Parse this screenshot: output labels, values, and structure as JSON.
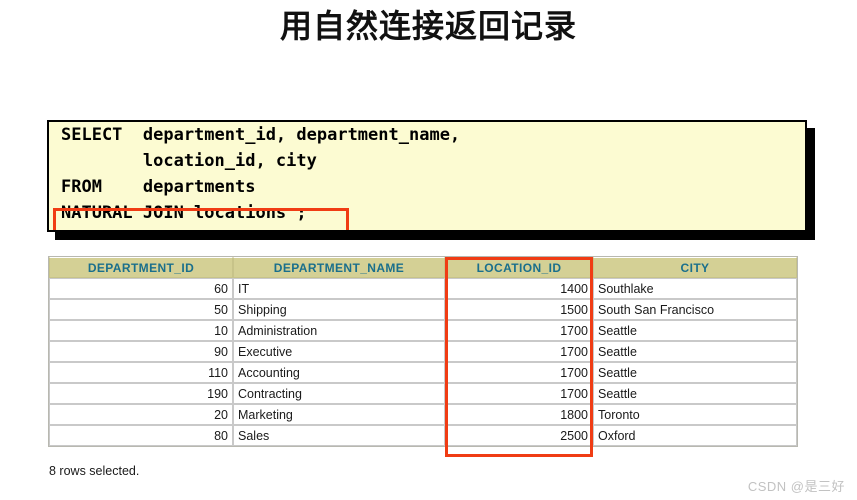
{
  "slide": {
    "title": "用自然连接返回记录"
  },
  "sql": {
    "lines": [
      "SELECT  department_id, department_name,",
      "        location_id, city",
      "FROM    departments",
      "NATURAL JOIN locations ;"
    ],
    "highlight_label": "NATURAL JOIN locations",
    "highlight_color": "#f03c14",
    "background_color": "#fcfbd2"
  },
  "table": {
    "headers": [
      "DEPARTMENT_ID",
      "DEPARTMENT_NAME",
      "LOCATION_ID",
      "CITY"
    ],
    "header_bg": "#d4d095",
    "header_color": "#1a6f8c",
    "rows": [
      {
        "department_id": "60",
        "department_name": "IT",
        "location_id": "1400",
        "city": "Southlake"
      },
      {
        "department_id": "50",
        "department_name": "Shipping",
        "location_id": "1500",
        "city": "South San Francisco"
      },
      {
        "department_id": "10",
        "department_name": "Administration",
        "location_id": "1700",
        "city": "Seattle"
      },
      {
        "department_id": "90",
        "department_name": "Executive",
        "location_id": "1700",
        "city": "Seattle"
      },
      {
        "department_id": "110",
        "department_name": "Accounting",
        "location_id": "1700",
        "city": "Seattle"
      },
      {
        "department_id": "190",
        "department_name": "Contracting",
        "location_id": "1700",
        "city": "Seattle"
      },
      {
        "department_id": "20",
        "department_name": "Marketing",
        "location_id": "1800",
        "city": "Toronto"
      },
      {
        "department_id": "80",
        "department_name": "Sales",
        "location_id": "2500",
        "city": "Oxford"
      }
    ]
  },
  "footer": {
    "rows_selected": "8 rows selected.",
    "watermark": "CSDN @是三好"
  }
}
